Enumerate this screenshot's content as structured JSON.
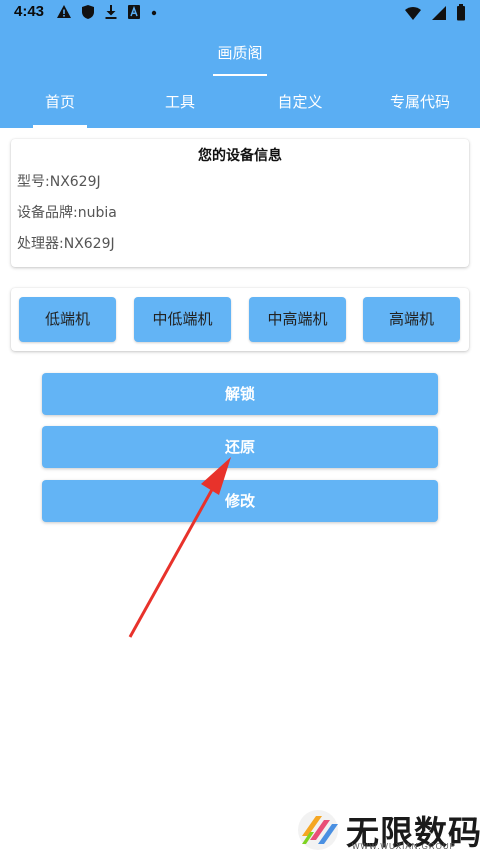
{
  "status_bar": {
    "time": "4:43",
    "left_icons": [
      "warning-icon",
      "shield-icon",
      "download-icon",
      "a-app-icon",
      "dot-icon"
    ],
    "right_icons": [
      "wifi-icon",
      "signal-icon",
      "battery-icon"
    ]
  },
  "app_bar": {
    "title": "画质阁"
  },
  "tabs": [
    {
      "label": "首页",
      "selected": true
    },
    {
      "label": "工具",
      "selected": false
    },
    {
      "label": "自定义",
      "selected": false
    },
    {
      "label": "专属代码",
      "selected": false
    }
  ],
  "device_info": {
    "title": "您的设备信息",
    "model": "型号:NX629J",
    "brand": "设备品牌:nubia",
    "processor": "处理器:NX629J"
  },
  "levels": [
    "低端机",
    "中低端机",
    "中高端机",
    "高端机"
  ],
  "actions": {
    "unlock": "解锁",
    "restore": "还原",
    "modify": "修改"
  },
  "annotation": {
    "arrow_color": "#e8322b"
  },
  "watermark": {
    "text": "无限数码",
    "subtext": "WWW.WUXIAN.GROUP"
  },
  "colors": {
    "primary": "#5aaef3",
    "button": "#63b4f5",
    "card_bg": "#ffffff"
  }
}
